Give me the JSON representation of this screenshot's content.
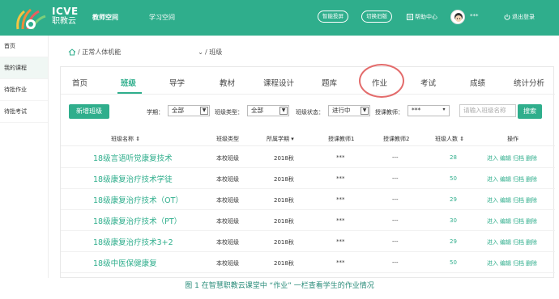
{
  "header": {
    "logo_en": "ICVE",
    "logo_zh": "职教云",
    "nav": [
      {
        "label": "教师空间"
      },
      {
        "label": "学习空间"
      }
    ],
    "pill_buttons": [
      {
        "label": "智能投屏"
      },
      {
        "label": "切换旧版"
      }
    ],
    "help_label": "帮助中心",
    "user_name": "***",
    "logout_label": "退出登录"
  },
  "sidebar": {
    "items": [
      {
        "label": "首页"
      },
      {
        "label": "我的课程"
      },
      {
        "label": "待批作业"
      },
      {
        "label": "待批考试"
      }
    ]
  },
  "breadcrumb": {
    "course": "/ 正常人体机能",
    "current": "/ 班级"
  },
  "tabs": [
    {
      "label": "首页"
    },
    {
      "label": "班级"
    },
    {
      "label": "导学"
    },
    {
      "label": "教材"
    },
    {
      "label": "课程设计"
    },
    {
      "label": "题库"
    },
    {
      "label": "作业"
    },
    {
      "label": "考试"
    },
    {
      "label": "成绩"
    },
    {
      "label": "统计分析"
    }
  ],
  "active_tab": "班级",
  "filters": {
    "add_button": "新增班级",
    "term_label": "学期：",
    "term_value": "全部",
    "type_label": "班级类型：",
    "type_value": "全部",
    "status_label": "班级状态：",
    "status_value": "进行中",
    "teacher_label": "授课教师：",
    "teacher_value": "***",
    "search_placeholder": "请输入班级名称",
    "search_button": "搜索"
  },
  "table": {
    "headers": [
      "班级名称",
      "班级类型",
      "所属学期",
      "授课教师1",
      "授课教师2",
      "班级人数",
      "操作"
    ],
    "rows": [
      {
        "name": "18级言语听觉康复技术",
        "type": "本校班级",
        "term": "2018秋",
        "teacher1": "***",
        "teacher2": "---",
        "count": "28"
      },
      {
        "name": "18级康复治疗技术学徒",
        "type": "本校班级",
        "term": "2018秋",
        "teacher1": "***",
        "teacher2": "---",
        "count": "50"
      },
      {
        "name": "18级康复治疗技术（OT）",
        "type": "本校班级",
        "term": "2018秋",
        "teacher1": "***",
        "teacher2": "---",
        "count": "29"
      },
      {
        "name": "18级康复治疗技术（PT）",
        "type": "本校班级",
        "term": "2018秋",
        "teacher1": "***",
        "teacher2": "---",
        "count": "30"
      },
      {
        "name": "18级康复治疗技术3+2",
        "type": "本校班级",
        "term": "2018秋",
        "teacher1": "***",
        "teacher2": "---",
        "count": "29"
      },
      {
        "name": "18级中医保健康复",
        "type": "本校班级",
        "term": "2018秋",
        "teacher1": "***",
        "teacher2": "---",
        "count": "50"
      }
    ],
    "ops": [
      "进入",
      "编辑",
      "归档",
      "删除"
    ]
  },
  "caption": "图 1 在智慧职教云课堂中 “作业” 一栏查看学生的作业情况",
  "colors": {
    "brand_green": "#2fae8c",
    "highlight_circle": "#e36b6b"
  }
}
